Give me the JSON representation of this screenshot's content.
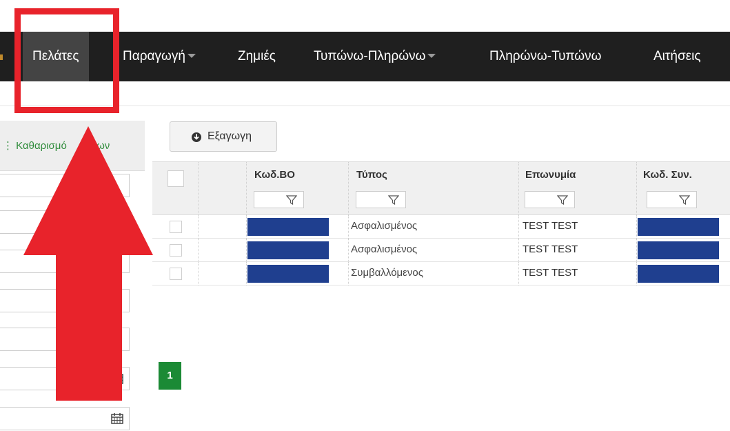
{
  "nav": {
    "items": [
      {
        "label": "Πελάτες",
        "active": true,
        "dropdown": false
      },
      {
        "label": "Παραγωγή",
        "active": false,
        "dropdown": true
      },
      {
        "label": "Ζημιές",
        "active": false,
        "dropdown": false
      },
      {
        "label": "Τυπώνω-Πληρώνω",
        "active": false,
        "dropdown": true
      },
      {
        "label": "Πληρώνω-Τυπώνω",
        "active": false,
        "dropdown": false
      },
      {
        "label": "Αιτήσεις",
        "active": false,
        "dropdown": false
      }
    ]
  },
  "sidebar": {
    "clear_filters_label": "Καθαρισμός φίλτρων",
    "clear_filters_visible": "Καθαρισμό",
    "clear_filters_tail": "λων",
    "icons": [
      "calendar-icon",
      "calendar-icon"
    ]
  },
  "toolbar": {
    "export_label": "Εξαγωγη",
    "export_icon": "download-circle-icon"
  },
  "grid": {
    "columns": [
      {
        "key": "code_bo",
        "label": "Κωδ.ΒΟ"
      },
      {
        "key": "type",
        "label": "Τύπος"
      },
      {
        "key": "name",
        "label": "Επωνυμία"
      },
      {
        "key": "code_syn",
        "label": "Κωδ. Συν."
      }
    ],
    "rows": [
      {
        "code_bo": "",
        "type": "Ασφαλισμένος",
        "name": "TEST TEST",
        "code_syn": ""
      },
      {
        "code_bo": "",
        "type": "Ασφαλισμένος",
        "name": "TEST TEST",
        "code_syn": ""
      },
      {
        "code_bo": "",
        "type": "Συμβαλλόμενος",
        "name": "TEST TEST",
        "code_syn": ""
      }
    ],
    "redaction_color": "#1f3f8f"
  },
  "pagination": {
    "current_page": "1",
    "color": "#1b8a35"
  },
  "annotation": {
    "color": "#e8232b"
  }
}
